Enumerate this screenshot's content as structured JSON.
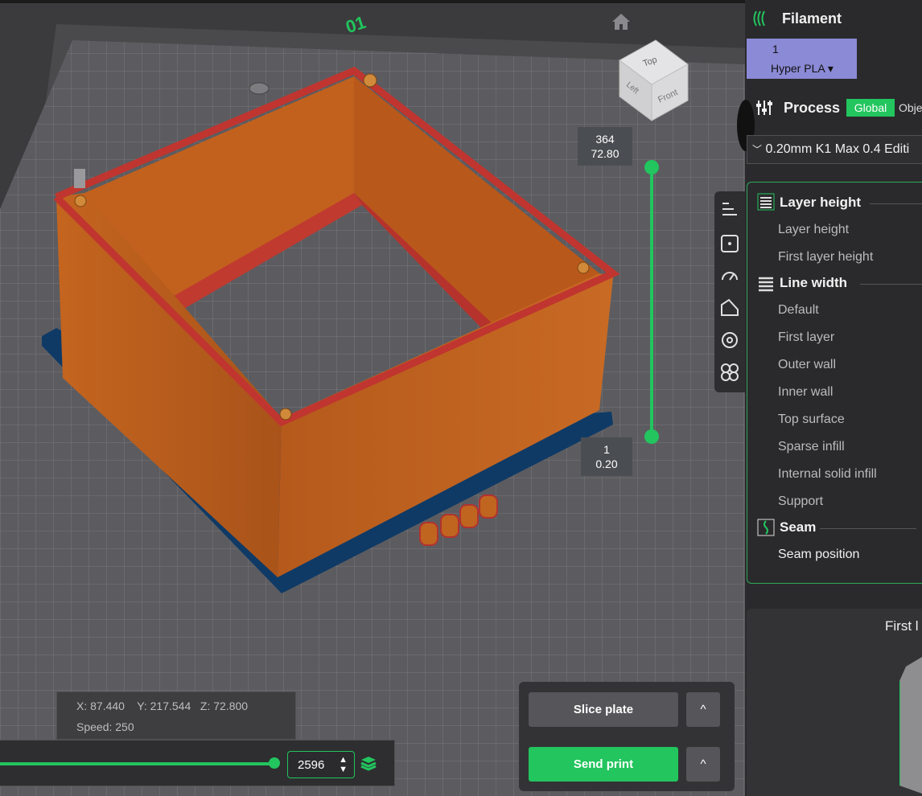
{
  "viewport": {
    "plate_number": "01",
    "layer_top": {
      "layer": "364",
      "height": "72.80"
    },
    "layer_bottom": {
      "layer": "1",
      "height": "0.20"
    },
    "coords": {
      "x_label": "X:",
      "x": "87.440",
      "y_label": "Y:",
      "y": "217.544",
      "z_label": "Z:",
      "z": "72.800",
      "speed_label": "Speed:",
      "speed": "250"
    },
    "move_value": "2596",
    "move_progress": 0.68
  },
  "view_cube": {
    "top": "Top",
    "left": "Left",
    "front": "Front"
  },
  "actions": {
    "slice_label": "Slice plate",
    "send_label": "Send print",
    "caret": "^"
  },
  "sidebar": {
    "filament": {
      "title": "Filament",
      "slot": "1",
      "name": "Hyper PLA"
    },
    "process": {
      "title": "Process",
      "global": "Global",
      "object": "Obje",
      "preset": "0.20mm K1 Max 0.4 Editi"
    },
    "groups": [
      {
        "title": "Layer height",
        "items": [
          "Layer height",
          "First layer height"
        ]
      },
      {
        "title": "Line width",
        "items": [
          "Default",
          "First layer",
          "Outer wall",
          "Inner wall",
          "Top surface",
          "Sparse infill",
          "Internal solid infill",
          "Support"
        ]
      },
      {
        "title": "Seam",
        "items": [
          "Seam position"
        ]
      }
    ],
    "preview_title": "First l"
  },
  "colors": {
    "accent": "#22c55e",
    "model": "#c0651f",
    "wall": "#b3322f",
    "brim": "#0f3a66"
  }
}
